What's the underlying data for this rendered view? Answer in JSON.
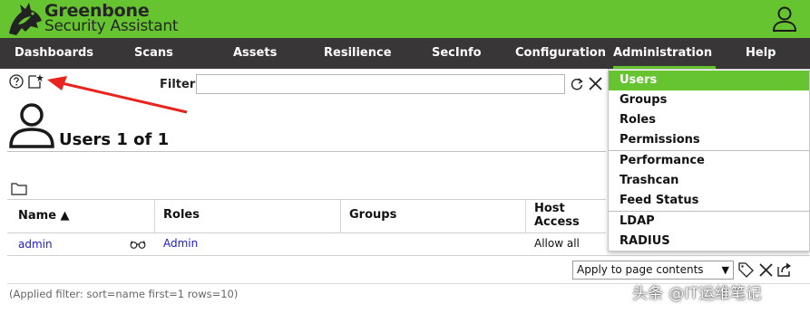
{
  "app": {
    "brand_name": "Greenbone",
    "brand_subtitle": "Security Assistant",
    "colors": {
      "brand_green": "#66c430",
      "menubar": "#393637",
      "link": "#1b1bd0"
    }
  },
  "menu": {
    "items": [
      {
        "label": "Dashboards"
      },
      {
        "label": "Scans"
      },
      {
        "label": "Assets"
      },
      {
        "label": "Resilience"
      },
      {
        "label": "SecInfo"
      },
      {
        "label": "Configuration"
      },
      {
        "label": "Administration",
        "active": true
      },
      {
        "label": "Help"
      }
    ]
  },
  "admin_dropdown": {
    "items": [
      {
        "label": "Users",
        "selected": true
      },
      {
        "label": "Groups"
      },
      {
        "label": "Roles"
      },
      {
        "label": "Permissions"
      },
      {
        "label": "Performance"
      },
      {
        "label": "Trashcan"
      },
      {
        "label": "Feed Status"
      },
      {
        "label": "LDAP"
      },
      {
        "label": "RADIUS"
      }
    ]
  },
  "toolbar": {
    "icons": [
      "help-icon",
      "new-user-icon",
      "refresh-icon",
      "clear-filter-icon",
      "folder-icon"
    ]
  },
  "filter": {
    "label": "Filter",
    "value": ""
  },
  "page": {
    "title": "Users 1 of 1"
  },
  "table": {
    "headers": {
      "name": "Name ▲",
      "roles": "Roles",
      "groups": "Groups",
      "host_access_line1": "Host",
      "host_access_line2": "Access"
    },
    "rows": [
      {
        "name": "admin",
        "roles": "Admin",
        "groups": "",
        "host_access": "Allow all"
      }
    ]
  },
  "bulk_action": {
    "selected": "Apply to page contents"
  },
  "applied_filter": "(Applied filter: sort=name first=1 rows=10)",
  "watermark": "头条 @IT运维笔记"
}
